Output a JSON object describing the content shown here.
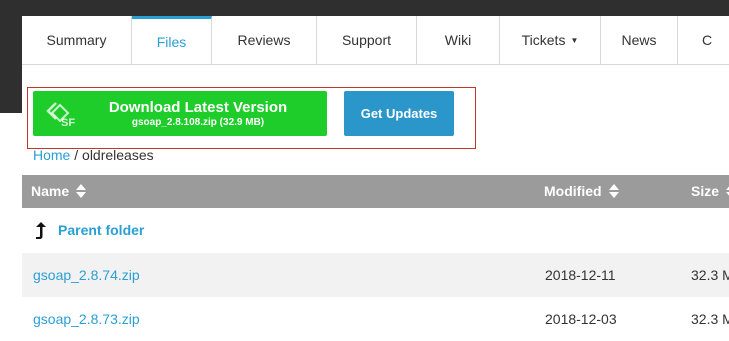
{
  "tabs": [
    {
      "label": "Summary"
    },
    {
      "label": "Files"
    },
    {
      "label": "Reviews"
    },
    {
      "label": "Support"
    },
    {
      "label": "Wiki"
    },
    {
      "label": "Tickets",
      "icon": "caret-down-icon"
    },
    {
      "label": "News"
    },
    {
      "label": "C"
    }
  ],
  "active_tab": "Files",
  "download": {
    "title": "Download Latest Version",
    "file": "gsoap_2.8.108.zip (32.9 MB)",
    "icon": "sourceforge-logo-icon",
    "color": "#1fcd2a"
  },
  "updates_label": "Get Updates",
  "breadcrumb": {
    "home": "Home",
    "separator": "/",
    "current": "oldreleases"
  },
  "table": {
    "headers": {
      "name": "Name",
      "modified": "Modified",
      "size": "Size"
    },
    "parent_label": "Parent folder",
    "rows": [
      {
        "name": "gsoap_2.8.74.zip",
        "modified": "2018-12-11",
        "size": "32.3 M"
      },
      {
        "name": "gsoap_2.8.73.zip",
        "modified": "2018-12-03",
        "size": "32.3 M"
      }
    ]
  },
  "colors": {
    "accent": "#2a9fd6",
    "header_bg": "#9b9b9b",
    "update_button": "#2a96c9"
  }
}
